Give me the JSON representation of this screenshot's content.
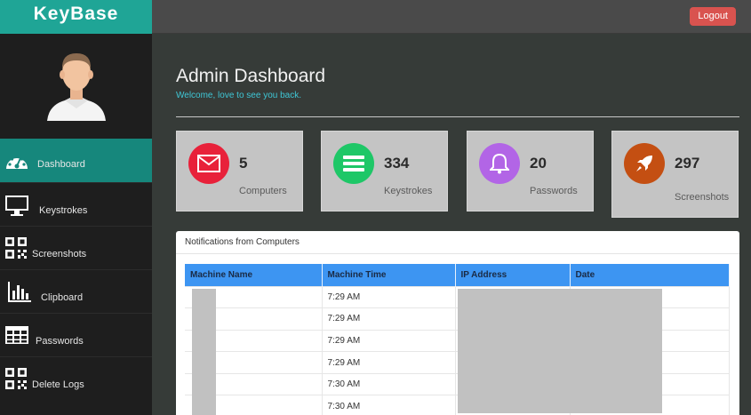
{
  "app": {
    "brand": "KeyBase"
  },
  "topbar": {
    "logout_label": "Logout"
  },
  "sidebar": {
    "items": [
      {
        "label": "Dashboard",
        "icon": "dashboard-icon",
        "active": true
      },
      {
        "label": "Keystrokes",
        "icon": "monitor-icon"
      },
      {
        "label": "Screenshots",
        "icon": "qr-code-icon"
      },
      {
        "label": "Clipboard",
        "icon": "bar-chart-icon"
      },
      {
        "label": "Passwords",
        "icon": "table-grid-icon"
      },
      {
        "label": "Delete Logs",
        "icon": "qr-code-icon"
      }
    ]
  },
  "main": {
    "title": "Admin Dashboard",
    "welcome": "Welcome, love to see you back.",
    "cards": [
      {
        "count": "5",
        "label": "Computers",
        "icon": "envelope-icon",
        "color": "#e8213a"
      },
      {
        "count": "334",
        "label": "Keystrokes",
        "icon": "list-icon",
        "color": "#1ec767"
      },
      {
        "count": "20",
        "label": "Passwords",
        "icon": "bell-icon",
        "color": "#b265e6"
      },
      {
        "count": "297",
        "label": "Screenshots",
        "icon": "rocket-icon",
        "color": "#c44f12"
      }
    ],
    "notifications": {
      "heading": "Notifications from Computers",
      "columns": [
        "Machine Name",
        "Machine Time",
        "IP Address",
        "Date"
      ],
      "rows": [
        [
          "",
          "7:29 AM",
          "",
          ""
        ],
        [
          "",
          "7:29 AM",
          "",
          ""
        ],
        [
          "",
          "7:29 AM",
          "",
          ""
        ],
        [
          "",
          "7:29 AM",
          "",
          ""
        ],
        [
          "",
          "7:30 AM",
          "",
          ""
        ],
        [
          "",
          "7:30 AM",
          "",
          ""
        ]
      ]
    }
  },
  "colors": {
    "accent": "#1fa596",
    "active": "#16877c",
    "table_header": "#3d95f2",
    "logout": "#d9534f"
  }
}
